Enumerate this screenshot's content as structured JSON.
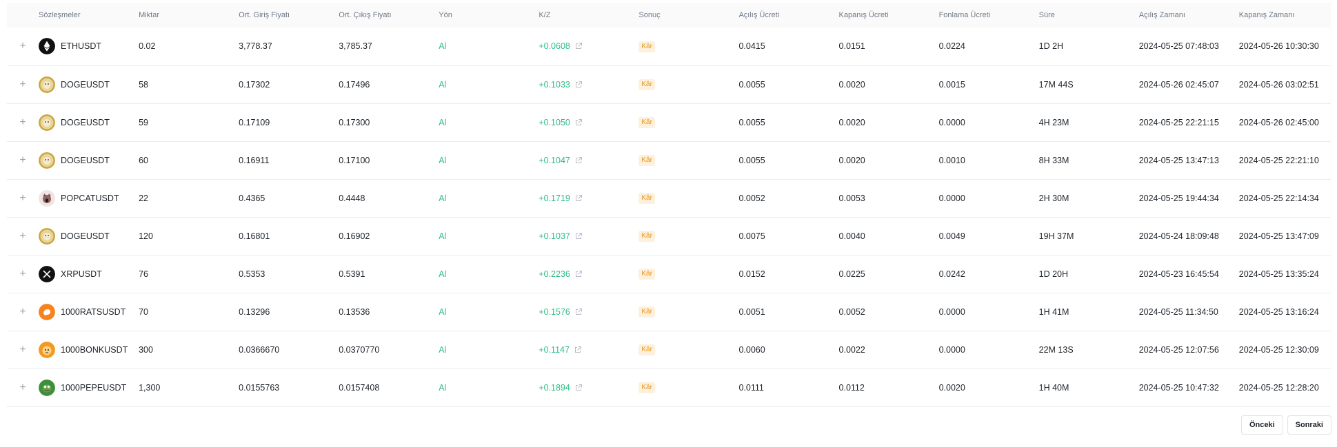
{
  "columns": [
    "Sözleşmeler",
    "Miktar",
    "Ort. Giriş Fiyatı",
    "Ort. Çıkış Fiyatı",
    "Yön",
    "K/Z",
    "Sonuç",
    "Açılış Ücreti",
    "Kapanış Ücreti",
    "Fonlama Ücreti",
    "Süre",
    "Açılış Zamanı",
    "Kapanış Zamanı"
  ],
  "expand_glyph": "+",
  "rows": [
    {
      "symbol": "ETHUSDT",
      "icon": "eth-icon",
      "qty": "0.02",
      "entry": "3,778.37",
      "exit": "3,785.37",
      "side": "Al",
      "pnl": "+0.0608",
      "result": "Kâr",
      "open_fee": "0.0415",
      "close_fee": "0.0151",
      "funding_fee": "0.0224",
      "duration": "1D 2H",
      "open_time": "2024-05-25 07:48:03",
      "close_time": "2024-05-26 10:30:30"
    },
    {
      "symbol": "DOGEUSDT",
      "icon": "doge-icon",
      "qty": "58",
      "entry": "0.17302",
      "exit": "0.17496",
      "side": "Al",
      "pnl": "+0.1033",
      "result": "Kâr",
      "open_fee": "0.0055",
      "close_fee": "0.0020",
      "funding_fee": "0.0015",
      "duration": "17M 44S",
      "open_time": "2024-05-26 02:45:07",
      "close_time": "2024-05-26 03:02:51"
    },
    {
      "symbol": "DOGEUSDT",
      "icon": "doge-icon",
      "qty": "59",
      "entry": "0.17109",
      "exit": "0.17300",
      "side": "Al",
      "pnl": "+0.1050",
      "result": "Kâr",
      "open_fee": "0.0055",
      "close_fee": "0.0020",
      "funding_fee": "0.0000",
      "duration": "4H 23M",
      "open_time": "2024-05-25 22:21:15",
      "close_time": "2024-05-26 02:45:00"
    },
    {
      "symbol": "DOGEUSDT",
      "icon": "doge-icon",
      "qty": "60",
      "entry": "0.16911",
      "exit": "0.17100",
      "side": "Al",
      "pnl": "+0.1047",
      "result": "Kâr",
      "open_fee": "0.0055",
      "close_fee": "0.0020",
      "funding_fee": "0.0010",
      "duration": "8H 33M",
      "open_time": "2024-05-25 13:47:13",
      "close_time": "2024-05-25 22:21:10"
    },
    {
      "symbol": "POPCATUSDT",
      "icon": "popcat-icon",
      "qty": "22",
      "entry": "0.4365",
      "exit": "0.4448",
      "side": "Al",
      "pnl": "+0.1719",
      "result": "Kâr",
      "open_fee": "0.0052",
      "close_fee": "0.0053",
      "funding_fee": "0.0000",
      "duration": "2H 30M",
      "open_time": "2024-05-25 19:44:34",
      "close_time": "2024-05-25 22:14:34"
    },
    {
      "symbol": "DOGEUSDT",
      "icon": "doge-icon",
      "qty": "120",
      "entry": "0.16801",
      "exit": "0.16902",
      "side": "Al",
      "pnl": "+0.1037",
      "result": "Kâr",
      "open_fee": "0.0075",
      "close_fee": "0.0040",
      "funding_fee": "0.0049",
      "duration": "19H 37M",
      "open_time": "2024-05-24 18:09:48",
      "close_time": "2024-05-25 13:47:09"
    },
    {
      "symbol": "XRPUSDT",
      "icon": "xrp-icon",
      "qty": "76",
      "entry": "0.5353",
      "exit": "0.5391",
      "side": "Al",
      "pnl": "+0.2236",
      "result": "Kâr",
      "open_fee": "0.0152",
      "close_fee": "0.0225",
      "funding_fee": "0.0242",
      "duration": "1D 20H",
      "open_time": "2024-05-23 16:45:54",
      "close_time": "2024-05-25 13:35:24"
    },
    {
      "symbol": "1000RATSUSDT",
      "icon": "rats-icon",
      "qty": "70",
      "entry": "0.13296",
      "exit": "0.13536",
      "side": "Al",
      "pnl": "+0.1576",
      "result": "Kâr",
      "open_fee": "0.0051",
      "close_fee": "0.0052",
      "funding_fee": "0.0000",
      "duration": "1H 41M",
      "open_time": "2024-05-25 11:34:50",
      "close_time": "2024-05-25 13:16:24"
    },
    {
      "symbol": "1000BONKUSDT",
      "icon": "bonk-icon",
      "qty": "300",
      "entry": "0.0366670",
      "exit": "0.0370770",
      "side": "Al",
      "pnl": "+0.1147",
      "result": "Kâr",
      "open_fee": "0.0060",
      "close_fee": "0.0022",
      "funding_fee": "0.0000",
      "duration": "22M 13S",
      "open_time": "2024-05-25 12:07:56",
      "close_time": "2024-05-25 12:30:09"
    },
    {
      "symbol": "1000PEPEUSDT",
      "icon": "pepe-icon",
      "qty": "1,300",
      "entry": "0.0155763",
      "exit": "0.0157408",
      "side": "Al",
      "pnl": "+0.1894",
      "result": "Kâr",
      "open_fee": "0.0111",
      "close_fee": "0.0112",
      "funding_fee": "0.0020",
      "duration": "1H 40M",
      "open_time": "2024-05-25 10:47:32",
      "close_time": "2024-05-25 12:28:20"
    }
  ],
  "pagination": {
    "prev": "Önceki",
    "next": "Sonraki"
  },
  "colors": {
    "profit": "#2ebd85",
    "badge_bg": "#fdf0dc",
    "badge_text": "#e8961a",
    "header_bg": "#fafafa"
  }
}
